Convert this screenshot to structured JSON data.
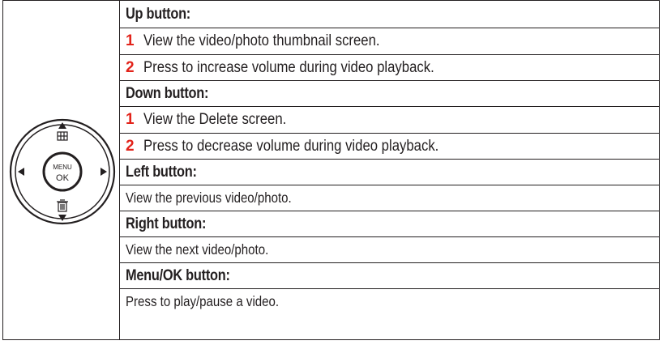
{
  "control": {
    "center_top": "MENU",
    "center_bottom": "OK"
  },
  "sections": {
    "up": {
      "heading": "Up button:",
      "steps": [
        {
          "num": "1",
          "text": "View the video/photo thumbnail screen."
        },
        {
          "num": "2",
          "text": "Press to increase volume during video playback."
        }
      ]
    },
    "down": {
      "heading": "Down button:",
      "steps": [
        {
          "num": "1",
          "text": "View the Delete screen."
        },
        {
          "num": "2",
          "text": "Press to decrease volume during video playback."
        }
      ]
    },
    "left": {
      "heading": "Left button:",
      "text": "View the previous video/photo."
    },
    "right": {
      "heading": "Right button:",
      "text": "View the next video/photo."
    },
    "menu_ok": {
      "heading": "Menu/OK button:",
      "text": "Press to play/pause a video."
    }
  },
  "colors": {
    "step_number": "#e2231a",
    "text": "#231f20",
    "border": "#231f20"
  }
}
